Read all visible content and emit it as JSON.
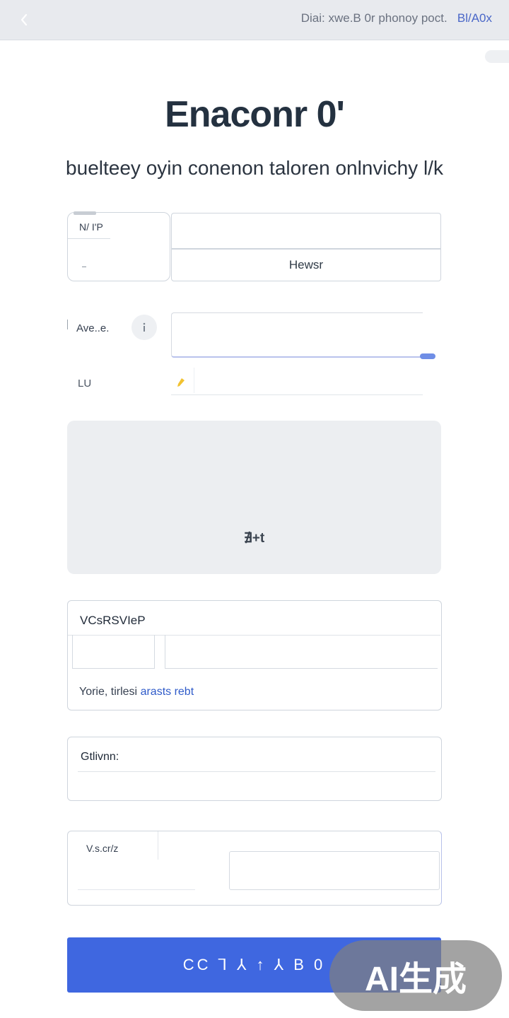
{
  "header": {
    "status_text": "Diai: xwe.B 0r phonoy poct.",
    "right_text": "Bl/A0x"
  },
  "page": {
    "title": "Enaconr 0'",
    "subtitle": "buelteey oyin conenon taloren onlnvichy l/k"
  },
  "form": {
    "row1": {
      "label": "N/ I'P",
      "button_label": "Hewsr"
    },
    "row2": {
      "label": "Ave..e."
    },
    "row3": {
      "label": "LU"
    },
    "upload": {
      "label": "∄+t"
    },
    "card1": {
      "title": "VCsRSVIeP",
      "hint_prefix": "Yorie, tirlesi",
      "hint_link": "arasts rebt"
    },
    "card2": {
      "title": "Gtlivnn:"
    },
    "card3": {
      "title": "V.s.cr/z"
    },
    "submit_label": "CC ⅂ ⅄ ↑ ⅄ B 0"
  },
  "watermark": {
    "text": "AI生成"
  },
  "colors": {
    "primary": "#3f67e0",
    "topbar_bg": "#e8eaee",
    "border": "#cfd5dd",
    "upload_bg": "#eceef1",
    "link": "#2f5bc9"
  },
  "icons": {
    "back": "chevron-left-icon",
    "info": "info-icon",
    "pencil": "pencil-icon"
  }
}
